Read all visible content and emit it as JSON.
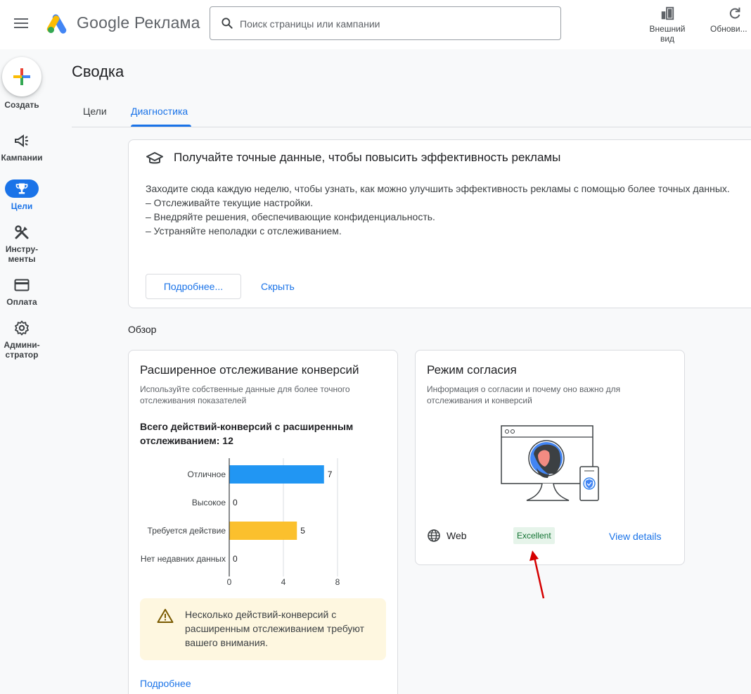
{
  "header": {
    "brand": "Google Реклама",
    "search_placeholder": "Поиск страницы или кампании",
    "appearance_label_1": "Внешний",
    "appearance_label_2": "вид",
    "refresh_label": "Обнови..."
  },
  "nav": {
    "create": "Создать",
    "campaigns": "Кампании",
    "goals": "Цели",
    "tools_1": "Инстру-",
    "tools_2": "менты",
    "billing": "Оплата",
    "admin_1": "Админи-",
    "admin_2": "стратор"
  },
  "page": {
    "title": "Сводка",
    "tabs": [
      "Цели",
      "Диагностика"
    ]
  },
  "info_card": {
    "title": "Получайте точные данные, чтобы повысить эффективность рекламы",
    "body_line_1": "Заходите сюда каждую неделю, чтобы узнать, как можно улучшить эффективность рекламы с помощью более точных данных.",
    "bullet_1": "– Отслеживайте текущие настройки.",
    "bullet_2": "– Внедряйте решения, обеспечивающие конфиденциальность.",
    "bullet_3": "– Устраняйте неполадки с отслеживанием.",
    "more_button": "Подробнее...",
    "hide_button": "Скрыть"
  },
  "overview_label": "Обзор",
  "ec_card": {
    "title": "Расширенное отслеживание конверсий",
    "subtitle_1": "Используйте собственные данные для более точного",
    "subtitle_2": "отслеживания показателей",
    "total": "Всего действий-конверсий с расширенным отслеживанием: 12",
    "warning": "Несколько действий-конверсий с расширенным отслеживанием требуют вашего внимания.",
    "more_link": "Подробнее"
  },
  "chart_data": {
    "type": "bar",
    "orientation": "horizontal",
    "categories": [
      "Отличное",
      "Высокое",
      "Требуется действие",
      "Нет недавних данных"
    ],
    "values": [
      7,
      0,
      5,
      0
    ],
    "colors": [
      "#2196f3",
      "#2196f3",
      "#fbc02d",
      "#fbc02d"
    ],
    "xlim": [
      0,
      8
    ],
    "xticks": [
      0,
      4,
      8
    ],
    "grid": true
  },
  "consent_card": {
    "title": "Режим согласия",
    "subtitle_1": "Информация о согласии и почему оно важно для",
    "subtitle_2": "отслеживания и конверсий",
    "platform": "Web",
    "status": "Excellent",
    "view_details": "View details"
  },
  "colors": {
    "accent": "#1a73e8",
    "bar_good": "#2196f3",
    "bar_action": "#fbc02d",
    "badge_bg": "#e6f4ea",
    "badge_text": "#137333",
    "warning_bg": "#fef7e0",
    "arrow": "#d50000"
  }
}
